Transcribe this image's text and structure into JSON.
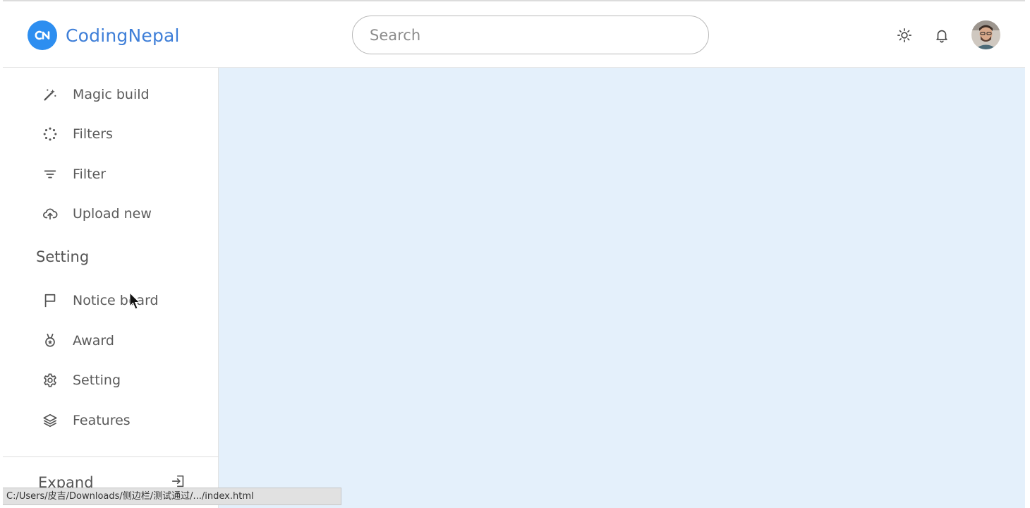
{
  "header": {
    "brand": "CodingNepal",
    "search_placeholder": "Search",
    "icons": [
      "sun-icon",
      "bell-icon"
    ],
    "accent_color": "#3f7fd8"
  },
  "sidebar": {
    "items_top": [
      {
        "label": "Magic build",
        "icon": "magic-wand-icon"
      },
      {
        "label": "Filters",
        "icon": "loader-dots-icon"
      },
      {
        "label": "Filter",
        "icon": "filter-lines-icon"
      },
      {
        "label": "Upload new",
        "icon": "cloud-upload-icon"
      }
    ],
    "section_title": "Setting",
    "items_setting": [
      {
        "label": "Notice board",
        "icon": "flag-icon"
      },
      {
        "label": "Award",
        "icon": "medal-icon"
      },
      {
        "label": "Setting",
        "icon": "gear-icon"
      },
      {
        "label": "Features",
        "icon": "layers-icon"
      }
    ],
    "expand_label": "Expand"
  },
  "statusbar": {
    "url": "C:/Users/皮吉/Downloads/侧边栏/测试通过/.../index.html"
  },
  "colors": {
    "content_bg": "#e4f0fb",
    "logo_bg": "#2d8ef0"
  }
}
